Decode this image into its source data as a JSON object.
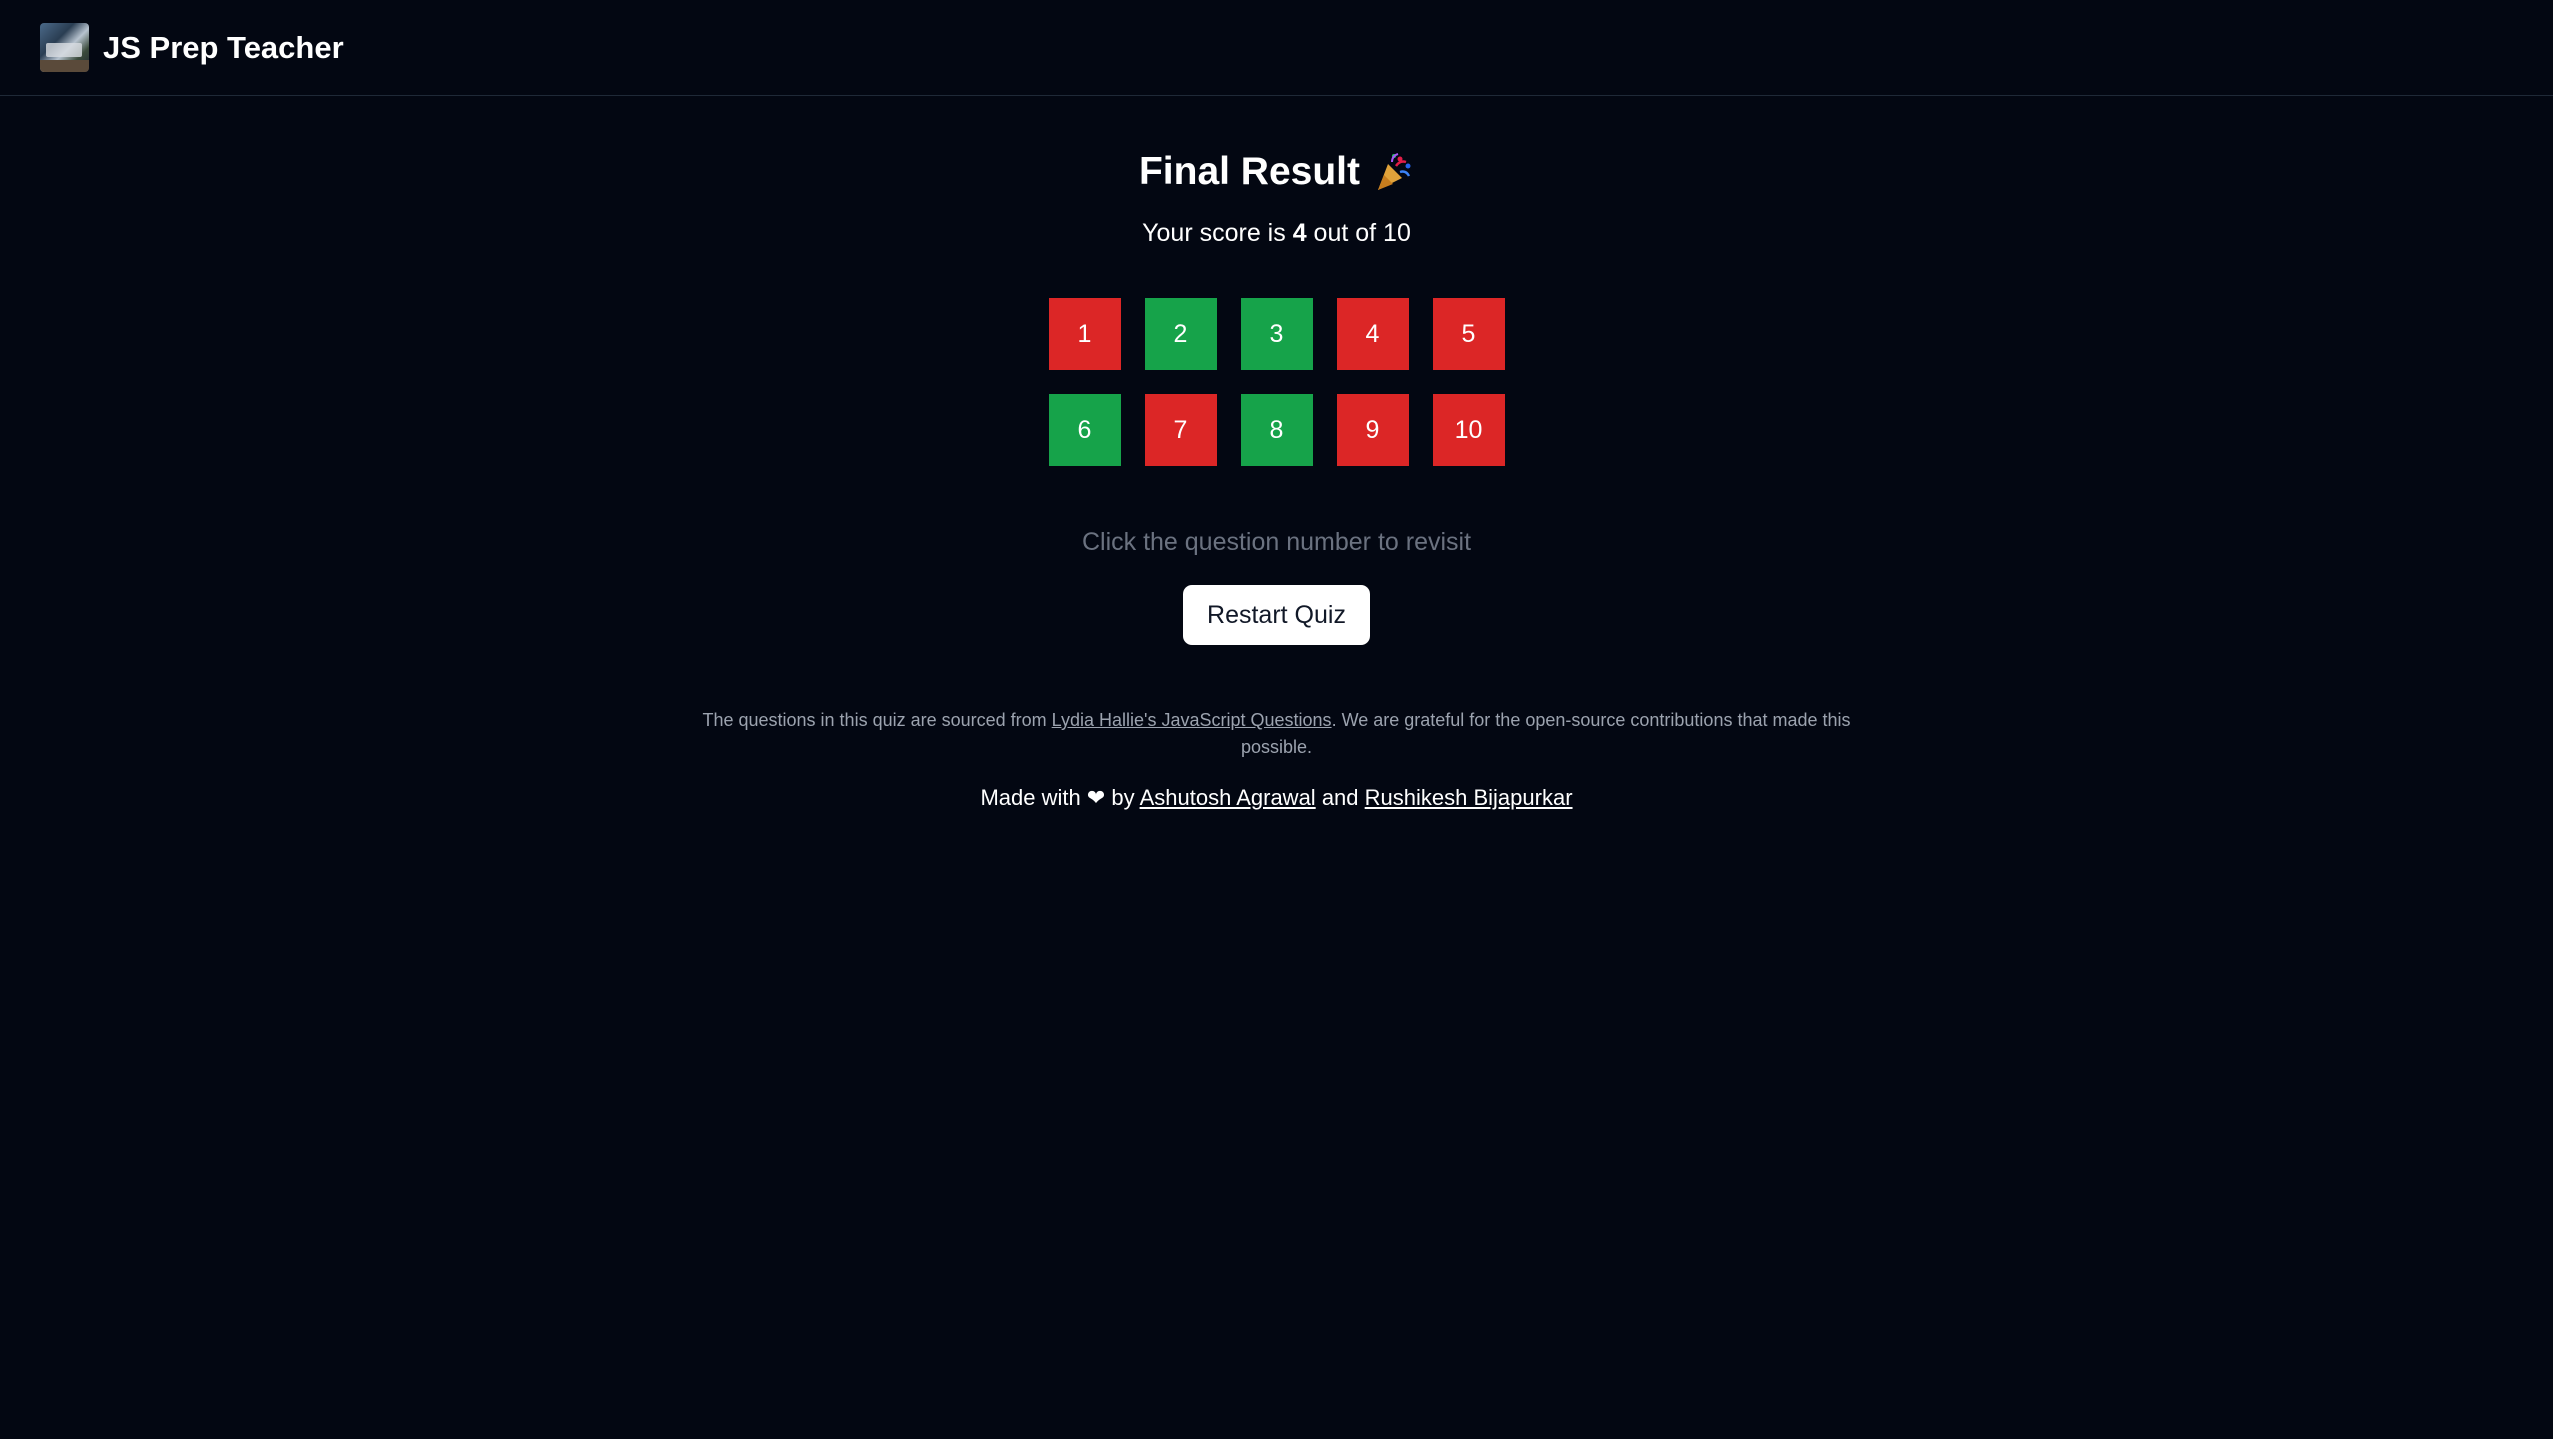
{
  "header": {
    "app_name": "JS Prep Teacher"
  },
  "result": {
    "title": "Final Result",
    "score_prefix": "Your score is",
    "score": "4",
    "score_suffix": "out of 10"
  },
  "questions": [
    {
      "num": "1",
      "status": "wrong"
    },
    {
      "num": "2",
      "status": "correct"
    },
    {
      "num": "3",
      "status": "correct"
    },
    {
      "num": "4",
      "status": "wrong"
    },
    {
      "num": "5",
      "status": "wrong"
    },
    {
      "num": "6",
      "status": "correct"
    },
    {
      "num": "7",
      "status": "wrong"
    },
    {
      "num": "8",
      "status": "correct"
    },
    {
      "num": "9",
      "status": "wrong"
    },
    {
      "num": "10",
      "status": "wrong"
    }
  ],
  "colors": {
    "correct": "#16a34a",
    "wrong": "#dc2626",
    "background": "#030712"
  },
  "hint": "Click the question number to revisit",
  "restart_label": "Restart Quiz",
  "credit": {
    "prefix": "The questions in this quiz are sourced from",
    "link_text": "Lydia Hallie's JavaScript Questions",
    "suffix": ". We are grateful for the open-source contributions that made this possible."
  },
  "made_with": {
    "prefix": "Made with",
    "heart": "❤",
    "by": "by",
    "author1": "Ashutosh Agrawal",
    "and": "and",
    "author2": "Rushikesh Bijapurkar"
  }
}
